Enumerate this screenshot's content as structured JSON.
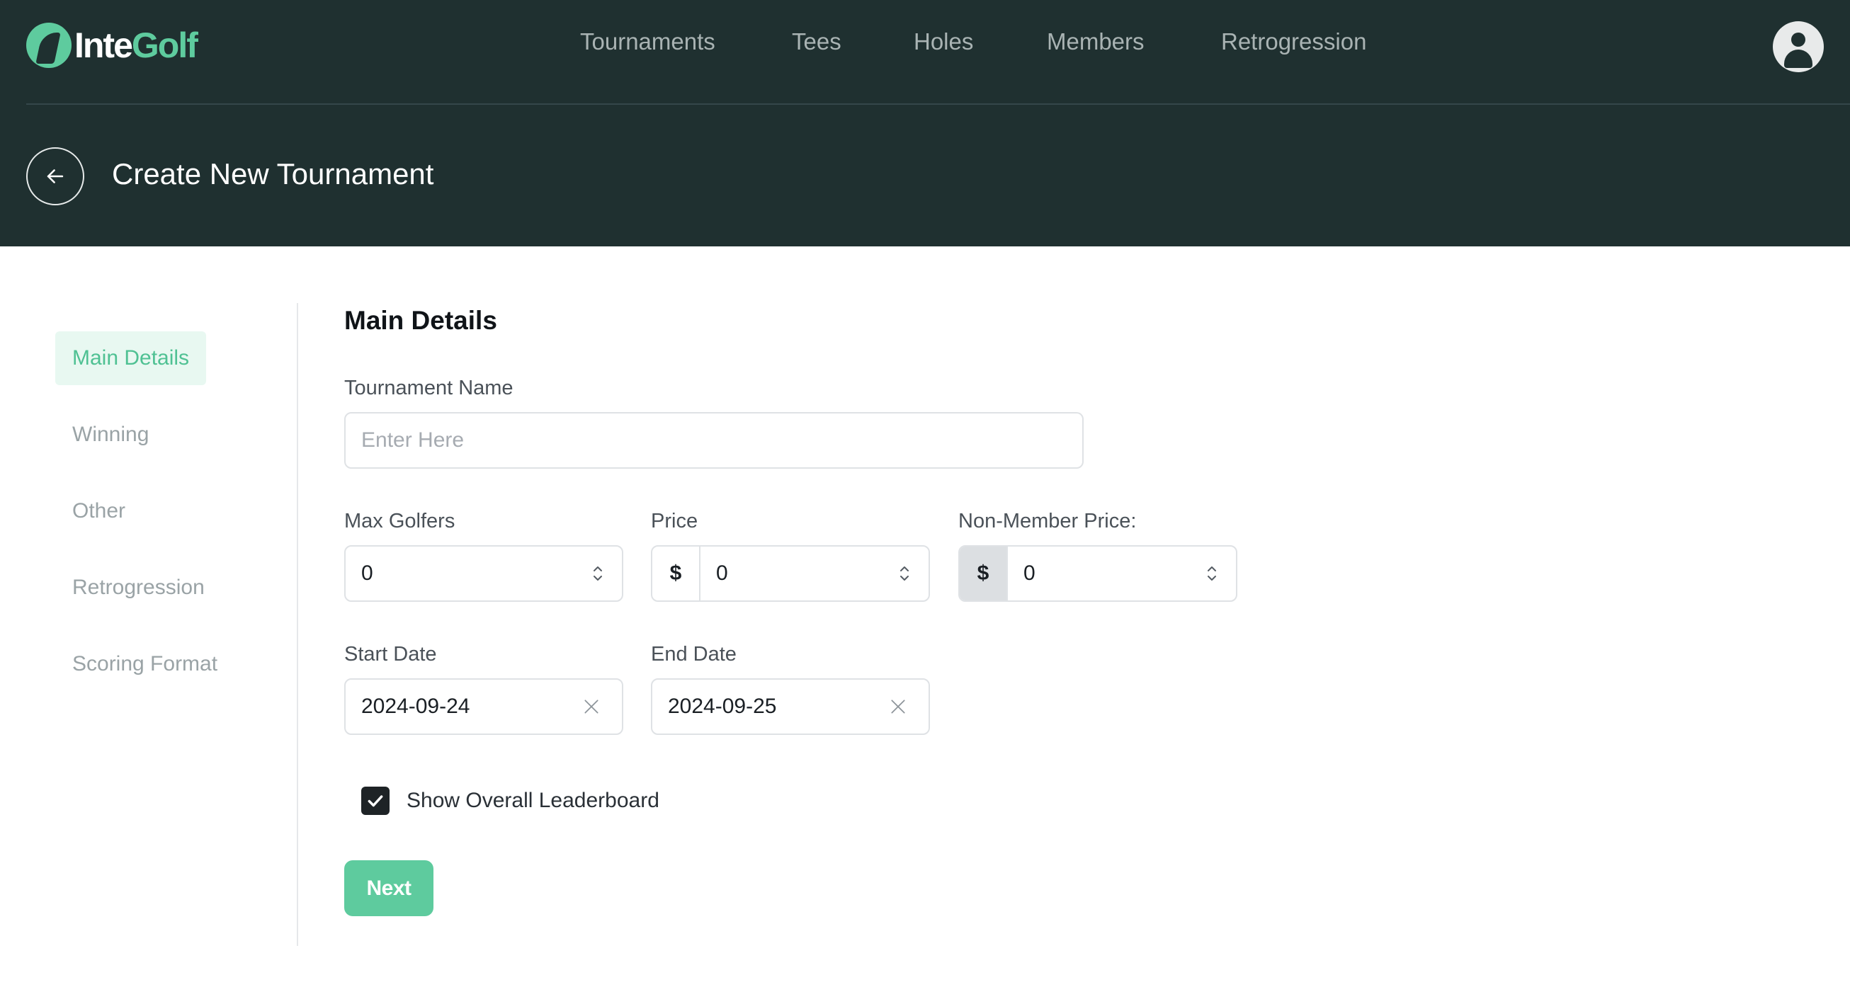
{
  "app": {
    "logo_part1": "Inte",
    "logo_part2": "Golf",
    "brand_color": "#5ecb9e",
    "header_color": "#1f3030"
  },
  "nav": {
    "items": [
      {
        "label": "Tournaments"
      },
      {
        "label": "Tees"
      },
      {
        "label": "Holes"
      },
      {
        "label": "Members"
      },
      {
        "label": "Retrogression"
      }
    ]
  },
  "page": {
    "title": "Create New Tournament",
    "back_icon": "arrow-left-icon"
  },
  "sidebar": {
    "items": [
      {
        "label": "Main Details",
        "active": true
      },
      {
        "label": "Winning"
      },
      {
        "label": "Other"
      },
      {
        "label": "Retrogression"
      },
      {
        "label": "Scoring Format"
      }
    ]
  },
  "form": {
    "section_title": "Main Details",
    "tournament_name": {
      "label": "Tournament Name",
      "value": "",
      "placeholder": "Enter Here"
    },
    "max_golfers": {
      "label": "Max Golfers",
      "value": "0"
    },
    "price": {
      "label": "Price",
      "prefix": "$",
      "value": "0"
    },
    "non_member_price": {
      "label": "Non-Member Price:",
      "prefix": "$",
      "value": "0"
    },
    "start_date": {
      "label": "Start Date",
      "value": "2024-09-24"
    },
    "end_date": {
      "label": "End Date",
      "value": "2024-09-25"
    },
    "show_leaderboard": {
      "label": "Show Overall Leaderboard",
      "checked": true
    },
    "next_label": "Next"
  }
}
